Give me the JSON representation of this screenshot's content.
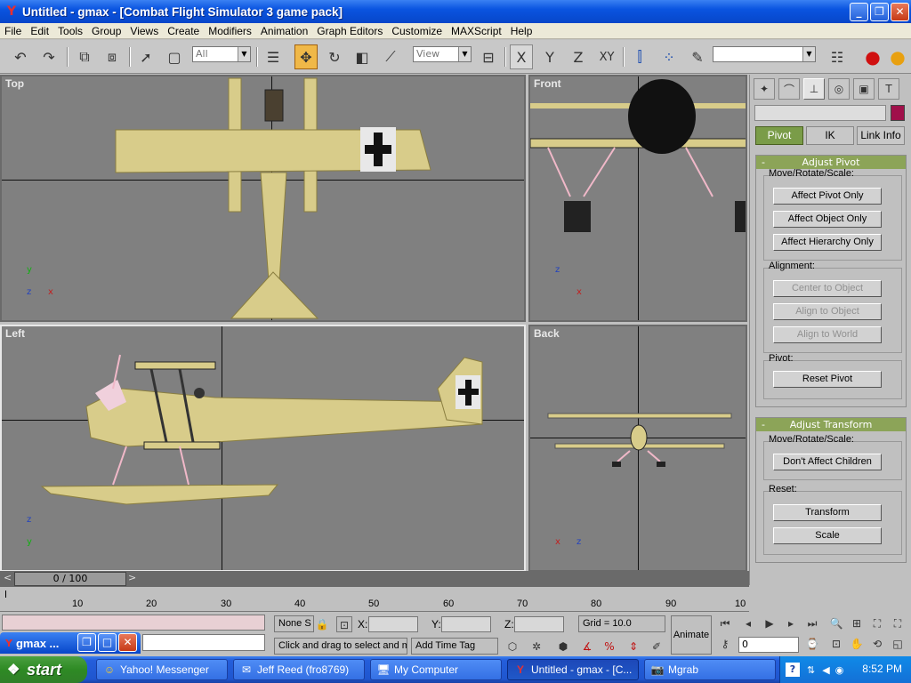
{
  "window": {
    "title": "Untitled - gmax - [Combat Flight Simulator 3 game pack]",
    "min": "_",
    "max": "❐",
    "close": "✕"
  },
  "menu": [
    "File",
    "Edit",
    "Tools",
    "Group",
    "Views",
    "Create",
    "Modifiers",
    "Animation",
    "Graph Editors",
    "Customize",
    "MAXScript",
    "Help"
  ],
  "toolbar": {
    "selection_filter": "All",
    "ref_coord": "View",
    "named_sel": ""
  },
  "viewports": {
    "top": "Top",
    "front": "Front",
    "left": "Left",
    "back": "Back"
  },
  "axes": {
    "x": "x",
    "y": "y",
    "z": "z"
  },
  "cmdpanel": {
    "subtabs": [
      "Pivot",
      "IK",
      "Link Info"
    ],
    "adjust_pivot": {
      "title": "Adjust Pivot",
      "move_label": "Move/Rotate/Scale:",
      "affect_pivot": "Affect Pivot Only",
      "affect_object": "Affect Object Only",
      "affect_hierarchy": "Affect Hierarchy Only",
      "alignment_label": "Alignment:",
      "center": "Center to Object",
      "align_obj": "Align to Object",
      "align_world": "Align to World",
      "pivot_label": "Pivot:",
      "reset_pivot": "Reset Pivot"
    },
    "adjust_transform": {
      "title": "Adjust Transform",
      "move_label": "Move/Rotate/Scale:",
      "dont_affect": "Don't Affect Children",
      "reset_label": "Reset:",
      "transform": "Transform",
      "scale": "Scale"
    }
  },
  "timeslider": {
    "frame": "0 / 100",
    "ticks": [
      "10",
      "20",
      "30",
      "40",
      "50",
      "60",
      "70",
      "80",
      "90",
      "10"
    ]
  },
  "status": {
    "selection": "None S",
    "x_label": "X:",
    "y_label": "Y:",
    "z_label": "Z:",
    "grid": "Grid = 10.0",
    "prompt": "Click and drag to select and m",
    "add_time_tag": "Add Time Tag",
    "animate": "Animate",
    "frame_field": "0"
  },
  "minimized": {
    "title": "gmax ..."
  },
  "taskbar": {
    "start": "start",
    "tasks": [
      "Yahoo! Messenger",
      "Jeff Reed (fro8769)",
      "My Computer",
      "Untitled - gmax - [C...",
      "Mgrab"
    ],
    "clock": "8:52 PM"
  },
  "colors": {
    "viewport_bg": "#808080",
    "plane": "#d8cc8a",
    "active_tool": "#f0b848",
    "rollout_header": "#8ca458"
  }
}
